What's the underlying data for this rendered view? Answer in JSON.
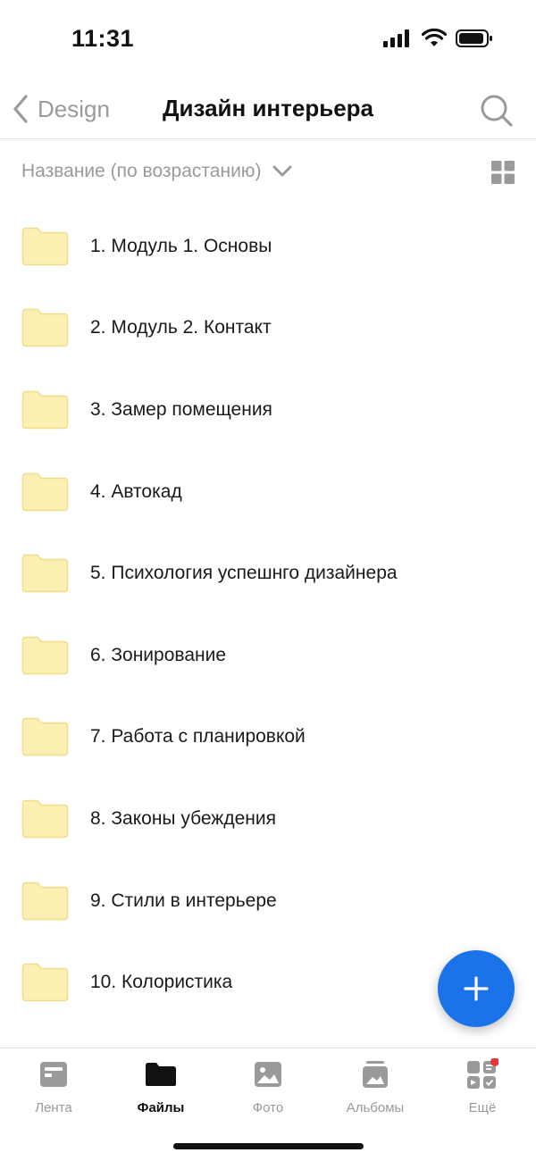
{
  "status_bar": {
    "time": "11:31"
  },
  "nav": {
    "back_label": "Design",
    "title": "Дизайн интерьера"
  },
  "sort": {
    "label": "Название (по возрастанию)"
  },
  "files": [
    {
      "name": "1. Модуль 1. Основы"
    },
    {
      "name": "2. Модуль 2. Контакт"
    },
    {
      "name": "3. Замер помещения"
    },
    {
      "name": "4. Автокад"
    },
    {
      "name": "5. Психология успешнго дизайнера"
    },
    {
      "name": "6. Зонирование"
    },
    {
      "name": "7. Работа с планировкой"
    },
    {
      "name": "8. Законы убеждения"
    },
    {
      "name": "9. Стили в интерьере"
    },
    {
      "name": "10. Колористика"
    }
  ],
  "tabs": [
    {
      "label": "Лента",
      "icon": "feed-icon"
    },
    {
      "label": "Файлы",
      "icon": "folder-icon",
      "active": true
    },
    {
      "label": "Фото",
      "icon": "photo-icon"
    },
    {
      "label": "Альбомы",
      "icon": "albums-icon"
    },
    {
      "label": "Ещё",
      "icon": "more-apps-icon",
      "badge": true
    }
  ],
  "colors": {
    "accent": "#1a73e8",
    "folder_fill": "#fdf0b3",
    "folder_stroke": "#f2dc8a",
    "muted_text": "#9a9a9a",
    "badge": "#e53935"
  }
}
